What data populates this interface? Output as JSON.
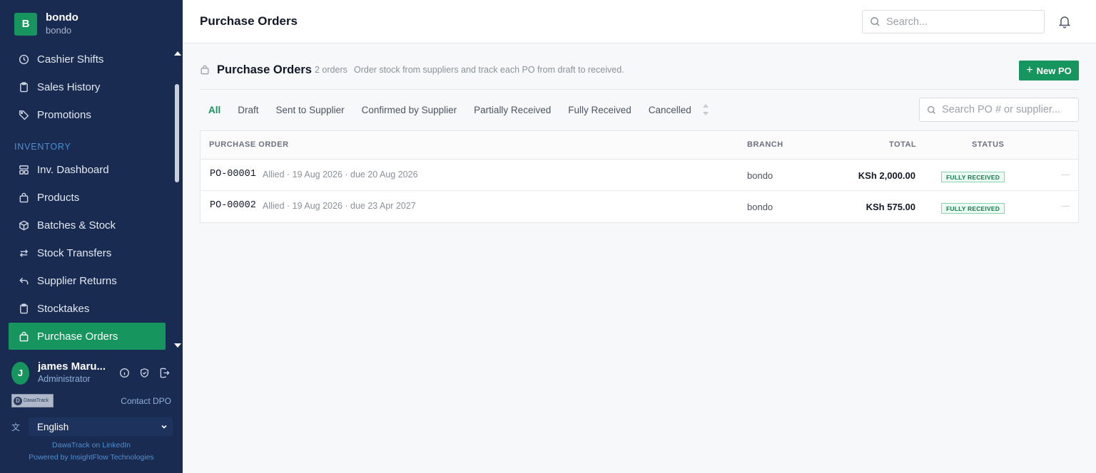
{
  "sidebar": {
    "brand_initial": "B",
    "brand_name": "bondo",
    "brand_sub": "bondo",
    "items_top": [
      {
        "label": "Cashier Shifts",
        "icon": "clock-icon"
      },
      {
        "label": "Sales History",
        "icon": "clipboard-icon"
      },
      {
        "label": "Promotions",
        "icon": "tag-icon"
      }
    ],
    "section_inventory": "INVENTORY",
    "items_inventory": [
      {
        "label": "Inv. Dashboard",
        "icon": "dashboard-icon"
      },
      {
        "label": "Products",
        "icon": "bag-icon"
      },
      {
        "label": "Batches & Stock",
        "icon": "box-icon"
      },
      {
        "label": "Stock Transfers",
        "icon": "transfer-icon"
      },
      {
        "label": "Supplier Returns",
        "icon": "return-icon"
      },
      {
        "label": "Stocktakes",
        "icon": "clipboard-icon"
      },
      {
        "label": "Purchase Orders",
        "icon": "bag-icon",
        "active": true
      }
    ],
    "user": {
      "initial": "J",
      "name": "james Maru...",
      "role": "Administrator"
    },
    "partner_logo": "DawaTrack",
    "contact": "Contact DPO",
    "language": "English",
    "footer_link": "DawaTrack on LinkedIn",
    "footer_powered": "Powered by InsightFlow Technologies"
  },
  "topbar": {
    "title": "Purchase Orders",
    "search_placeholder": "Search..."
  },
  "page": {
    "title": "Purchase Orders",
    "count": "2 orders",
    "description": "Order stock from suppliers and track each PO from draft to received.",
    "new_button": "New PO",
    "tabs": [
      "All",
      "Draft",
      "Sent to Supplier",
      "Confirmed by Supplier",
      "Partially Received",
      "Fully Received",
      "Cancelled"
    ],
    "active_tab": "All",
    "po_search_placeholder": "Search PO # or supplier..."
  },
  "table": {
    "headers": {
      "order": "PURCHASE ORDER",
      "branch": "BRANCH",
      "total": "TOTAL",
      "status": "STATUS"
    },
    "rows": [
      {
        "number": "PO-00001",
        "meta": "Allied · 19 Aug 2026 · due 20 Aug 2026",
        "branch": "bondo",
        "total": "KSh 2,000.00",
        "status": "FULLY RECEIVED"
      },
      {
        "number": "PO-00002",
        "meta": "Allied · 19 Aug 2026 · due 23 Apr 2027",
        "branch": "bondo",
        "total": "KSh 575.00",
        "status": "FULLY RECEIVED"
      }
    ]
  },
  "colors": {
    "sidebar_bg": "#1a2b52",
    "accent": "#16955e",
    "section_label": "#4e8fd1"
  }
}
